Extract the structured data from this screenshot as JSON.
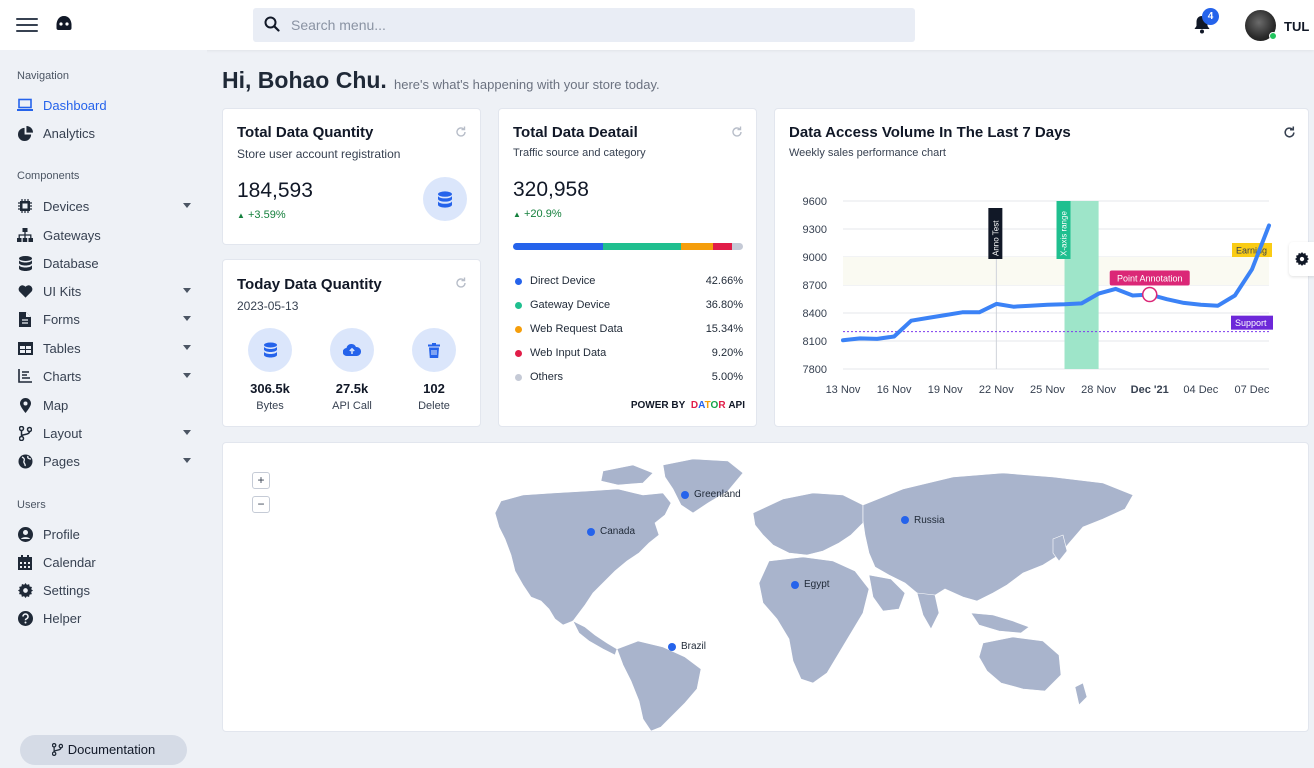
{
  "header": {
    "search_placeholder": "Search menu...",
    "notification_count": "4",
    "user_name": "TUL"
  },
  "sidebar": {
    "sections": [
      "Navigation",
      "Components",
      "Users"
    ],
    "items": [
      {
        "label": "Dashboard",
        "icon": "laptop-icon"
      },
      {
        "label": "Analytics",
        "icon": "pie-chart-icon"
      },
      {
        "label": "Devices",
        "icon": "chip-icon"
      },
      {
        "label": "Gateways",
        "icon": "sitemap-icon"
      },
      {
        "label": "Database",
        "icon": "database-icon"
      },
      {
        "label": "UI Kits",
        "icon": "heart-icon"
      },
      {
        "label": "Forms",
        "icon": "file-icon"
      },
      {
        "label": "Tables",
        "icon": "table-icon"
      },
      {
        "label": "Charts",
        "icon": "chart-icon"
      },
      {
        "label": "Map",
        "icon": "map-pin-icon"
      },
      {
        "label": "Layout",
        "icon": "branch-icon"
      },
      {
        "label": "Pages",
        "icon": "globe-icon"
      },
      {
        "label": "Profile",
        "icon": "user-icon"
      },
      {
        "label": "Calendar",
        "icon": "calendar-icon"
      },
      {
        "label": "Settings",
        "icon": "gear-icon"
      },
      {
        "label": "Helper",
        "icon": "question-icon"
      }
    ],
    "documentation": "Documentation"
  },
  "greeting": {
    "title": "Hi, Bohao Chu.",
    "subtitle": "here's what's happening with your store today."
  },
  "total_quantity": {
    "title": "Total Data Quantity",
    "subtitle": "Store user account registration",
    "value": "184,593",
    "change": "+3.59%"
  },
  "today_quantity": {
    "title": "Today Data Quantity",
    "date": "2023-05-13",
    "stats": [
      {
        "value": "306.5k",
        "label": "Bytes"
      },
      {
        "value": "27.5k",
        "label": "API Call"
      },
      {
        "value": "102",
        "label": "Delete"
      }
    ]
  },
  "detail": {
    "title": "Total Data Deatail",
    "subtitle": "Traffic source and category",
    "value": "320,958",
    "change": "+20.9%",
    "items": [
      {
        "name": "Direct Device",
        "pct": "42.66%",
        "share": 42.66,
        "color": "#2563eb"
      },
      {
        "name": "Gateway Device",
        "pct": "36.80%",
        "share": 36.8,
        "color": "#1fbf8f"
      },
      {
        "name": "Web Request Data",
        "pct": "15.34%",
        "share": 15.34,
        "color": "#f59e0b"
      },
      {
        "name": "Web Input Data",
        "pct": "9.20%",
        "share": 9.2,
        "color": "#e11d48"
      },
      {
        "name": "Others",
        "pct": "5.00%",
        "share": 5.0,
        "color": "#c5cad6"
      }
    ],
    "power_prefix": "POWER BY",
    "power_letters": [
      "D",
      "A",
      "T",
      "O",
      "R"
    ],
    "power_colors": [
      "#e11d48",
      "#2563eb",
      "#f59e0b",
      "#16a34a",
      "#e11d48"
    ],
    "power_suffix": "API"
  },
  "access_chart": {
    "title": "Data Access Volume In The Last 7 Days",
    "subtitle": "Weekly sales performance chart"
  },
  "chart_data": {
    "type": "line",
    "x_ticks": [
      "13 Nov",
      "16 Nov",
      "19 Nov",
      "22 Nov",
      "25 Nov",
      "28 Nov",
      "Dec '21",
      "04 Dec",
      "07 Dec"
    ],
    "y_ticks": [
      7800,
      8100,
      8400,
      8700,
      9000,
      9300,
      9600
    ],
    "ylim": [
      7800,
      9600
    ],
    "x": [
      "2021-11-13",
      "2021-11-14",
      "2021-11-15",
      "2021-11-16",
      "2021-11-17",
      "2021-11-18",
      "2021-11-19",
      "2021-11-20",
      "2021-11-21",
      "2021-11-22",
      "2021-11-23",
      "2021-11-24",
      "2021-11-25",
      "2021-11-26",
      "2021-11-27",
      "2021-11-28",
      "2021-11-29",
      "2021-11-30",
      "2021-12-01",
      "2021-12-02",
      "2021-12-03",
      "2021-12-04",
      "2021-12-05",
      "2021-12-06",
      "2021-12-07",
      "2021-12-08"
    ],
    "series": [
      {
        "color": "#3b82f6",
        "values": [
          8107,
          8128,
          8122,
          8148,
          8318,
          8348,
          8378,
          8408,
          8408,
          8498,
          8468,
          8478,
          8488,
          8493,
          8503,
          8608,
          8658,
          8588,
          8598,
          8548,
          8508,
          8488,
          8478,
          8588,
          8868,
          9338
        ]
      }
    ],
    "annotations": {
      "x_lines": [
        {
          "x": "2021-11-22",
          "label": "Anno Test"
        }
      ],
      "x_range": {
        "from": "2021-11-26",
        "to": "2021-11-28",
        "label": "X-axis range"
      },
      "y_line": {
        "y": 8200,
        "label": "Support"
      },
      "points": [
        {
          "x": "2021-12-01",
          "y": 8598,
          "label": "Point Annotation"
        }
      ],
      "label_earning": "Earning"
    }
  },
  "map": {
    "zoom_in": "+",
    "zoom_out": "−",
    "markers": [
      "Greenland",
      "Canada",
      "Russia",
      "Egypt",
      "Brazil"
    ]
  }
}
